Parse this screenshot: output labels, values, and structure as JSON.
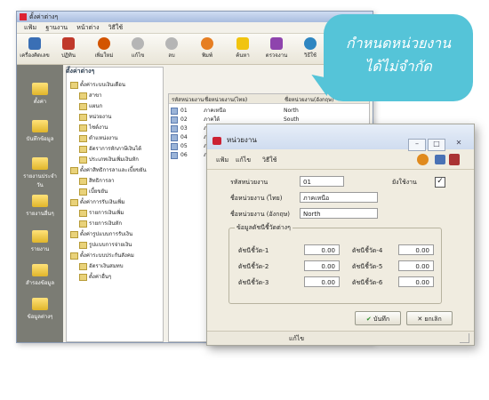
{
  "main_window": {
    "title": "ตั้งค่าต่างๆ",
    "menu": [
      "แฟ้ม",
      "ฐานงาน",
      "หน้าต่าง",
      "วิธีใช้"
    ],
    "toolbar": [
      {
        "label": "เครื่องคิดเลข",
        "icon": "calculator-icon",
        "color": "#3a6fb5"
      },
      {
        "label": "ปฏิทิน",
        "icon": "calendar-icon",
        "color": "#c0392b"
      },
      {
        "label": "เพิ่มใหม่",
        "icon": "add-icon",
        "color": "#d35400"
      },
      {
        "label": "แก้ไข",
        "icon": "edit-icon",
        "color": "#9a9a9a"
      },
      {
        "label": "ลบ",
        "icon": "delete-icon",
        "color": "#9a9a9a"
      },
      {
        "label": "พิมพ์",
        "icon": "print-icon",
        "color": "#e67e22"
      },
      {
        "label": "ค้นหา",
        "icon": "search-icon",
        "color": "#f1c40f"
      },
      {
        "label": "ตรวจงาน",
        "icon": "check-icon",
        "color": "#8e44ad"
      },
      {
        "label": "วิธีใช้",
        "icon": "help-icon",
        "color": "#2e86c1"
      }
    ],
    "sidebar": [
      {
        "label": "ตั้งค่า"
      },
      {
        "label": "บันทึกข้อมูล"
      },
      {
        "label": "รายงานประจำวัน"
      },
      {
        "label": "รายงานอื่นๆ"
      },
      {
        "label": "รายงาน"
      },
      {
        "label": "สำรองข้อมูล"
      },
      {
        "label": "ข้อมูลต่างๆ"
      }
    ],
    "tree_header": "ตั้งค่าต่างๆ",
    "tree_items": [
      "ตั้งค่าระบบเงินเดือน",
      "สาขา",
      "แผนก",
      "หน่วยงาน",
      "ไซต์งาน",
      "ตำแหน่งงาน",
      "อัตราการหักภาษีเงินได้",
      "ประเภทเงินเพิ่มเงินหัก",
      "ตั้งค่าสิทธิการลาและเบี้ยขยัน",
      "สิทธิการลา",
      "เบี้ยขยัน",
      "ตั้งค่าการรับเงินเพิ่ม",
      "รายการเงินเพิ่ม",
      "รายการเงินหัก",
      "ตั้งค่ารูปแบบการรับเงิน",
      "รูปแบบการจ่ายเงิน",
      "ตั้งค่าระบบประกันสังคม",
      "อัตราเงินสมทบ",
      "ตั้งค่าอื่นๆ"
    ],
    "list_headers": [
      "รหัสหน่วยงาน",
      "ชื่อหน่วยงาน(ไทย)",
      "ชื่อหน่วยงาน(อังกฤษ)"
    ],
    "list_rows": [
      {
        "code": "01",
        "thai": "ภาคเหนือ",
        "eng": "North"
      },
      {
        "code": "02",
        "thai": "ภาคใต้",
        "eng": "South"
      },
      {
        "code": "03",
        "thai": "ภาคอีสาน",
        "eng": ""
      },
      {
        "code": "04",
        "thai": "ภาคกลาง",
        "eng": "Central Region"
      },
      {
        "code": "05",
        "thai": "ภาคตะวันออก",
        "eng": "East"
      },
      {
        "code": "06",
        "thai": "ภาคตะวันตก",
        "eng": ""
      }
    ]
  },
  "callout": {
    "line1": "กำหนดหน่วยงาน",
    "line2": "ได้ไม่จำกัด",
    "color": "#55c4d8"
  },
  "dialog": {
    "title": "หน่วยงาน",
    "menu": [
      "แฟ้ม",
      "แก้ไข",
      "วิธีใช้"
    ],
    "fields": {
      "code_label": "รหัสหน่วยงาน",
      "code_value": "01",
      "active_label": "ยังใช้งาน",
      "active_checked": true,
      "thai_label": "ชื่อหน่วยงาน (ไทย)",
      "thai_value": "ภาคเหนือ",
      "eng_label": "ชื่อหน่วยงาน (อังกฤษ)",
      "eng_value": "North"
    },
    "stats_group_label": "ข้อมูลดัชนีชี้วัดต่างๆ",
    "stats": [
      {
        "label": "ดัชนีชี้วัด-1",
        "value": "0.00"
      },
      {
        "label": "ดัชนีชี้วัด-2",
        "value": "0.00"
      },
      {
        "label": "ดัชนีชี้วัด-3",
        "value": "0.00"
      },
      {
        "label": "ดัชนีชี้วัด-4",
        "value": "0.00"
      },
      {
        "label": "ดัชนีชี้วัด-5",
        "value": "0.00"
      },
      {
        "label": "ดัชนีชี้วัด-6",
        "value": "0.00"
      }
    ],
    "save_label": "บันทึก",
    "cancel_label": "ยกเลิก",
    "status": "แก้ไข"
  }
}
